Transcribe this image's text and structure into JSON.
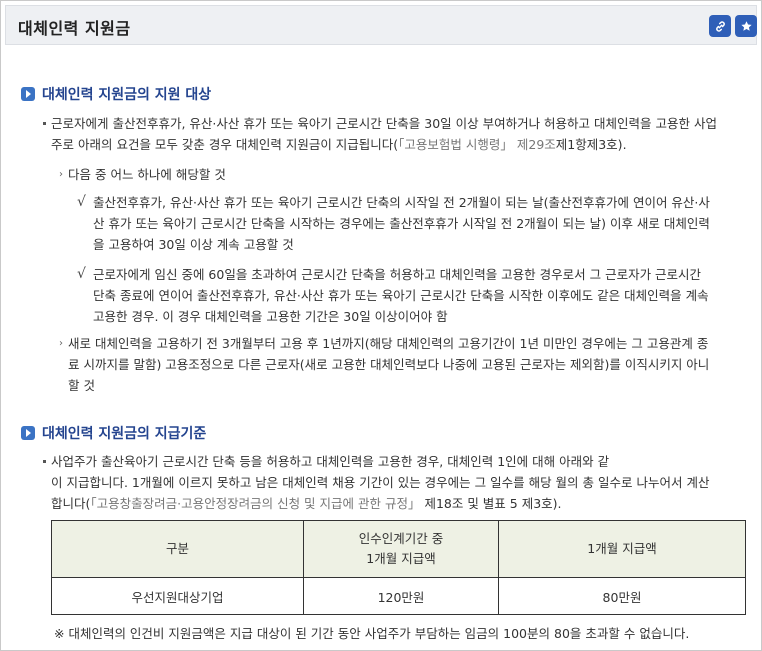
{
  "header": {
    "title": "대체인력 지원금",
    "link_icon": "link-icon",
    "bookmark_icon": "star-icon"
  },
  "section1": {
    "title": "대체인력 지원금의 지원 대상",
    "intro_line1": "근로자에게 출산전후휴가, 유산·사산 휴가 또는 육아기 근로시간 단축을 30일 이상 부여하거나 허용하고 대체인력을 고용한 사업",
    "intro_line2_a": "주로 아래의 요건을 모두 갖춘 경우 대체인력 지원금이 지급됩니다(",
    "intro_line2_ref": "「고용보험법 시행령」 제29조",
    "intro_line2_b": "제1항제3호).",
    "cond1_title": "다음 중 어느 하나에 해당할 것",
    "cond1_a_l1": "출산전후휴가, 유산·사산 휴가 또는 육아기 근로시간 단축의 시작일 전 2개월이 되는 날(출산전후휴가에 연이어 유산·사",
    "cond1_a_l2": "산 휴가 또는 육아기 근로시간 단축을 시작하는 경우에는 출산전후휴가 시작일 전 2개월이 되는 날) 이후 새로 대체인력",
    "cond1_a_l3": "을 고용하여 30일 이상 계속 고용할 것",
    "cond1_b_l1": "근로자에게 임신 중에 60일을 초과하여 근로시간 단축을 허용하고 대체인력을 고용한 경우로서 그 근로자가 근로시간",
    "cond1_b_l2": "단축 종료에 연이어 출산전후휴가, 유산·사산 휴가 또는 육아기 근로시간 단축을 시작한 이후에도 같은 대체인력을 계속",
    "cond1_b_l3": "고용한 경우. 이 경우 대체인력을 고용한 기간은 30일 이상이어야 함",
    "cond2_l1": "새로 대체인력을 고용하기 전 3개월부터 고용 후 1년까지(해당 대체인력의 고용기간이 1년 미만인 경우에는 그 고용관계 종",
    "cond2_l2": "료 시까지를 말함) 고용조정으로 다른 근로자(새로 고용한 대체인력보다 나중에 고용된 근로자는 제외함)를 이직시키지 아니",
    "cond2_l3": "할 것"
  },
  "section2": {
    "title": "대체인력 지원금의 지급기준",
    "body_l1": "사업주가 출산육아기 근로시간 단축 등을 허용하고 대체인력을 고용한 경우, 대체인력 1인에 대해 아래와 같",
    "body_l2": "이 지급합니다. 1개월에 이르지 못하고 남은 대체인력 채용 기간이 있는 경우에는 그 일수를 해당 월의 총 일수로 나누어서 계산",
    "body_l3_a": "합니다(",
    "body_l3_ref": "「고용창출장려금·고용안정장려금의 신청 및 지급에 관한 규정」",
    "body_l3_b": " 제18조 및 별표 5 제3호).",
    "table": {
      "headers": [
        "구분",
        "인수인계기간 중",
        "1개월 지급액",
        "1개월 지급액"
      ],
      "row": [
        "우선지원대상기업",
        "120만원",
        "80만원"
      ]
    },
    "note": "※ 대체인력의 인건비 지원금액은 지급 대상이 된 기간 동안 사업주가 부담하는 임금의 100분의 80을 초과할 수 없습니다."
  }
}
